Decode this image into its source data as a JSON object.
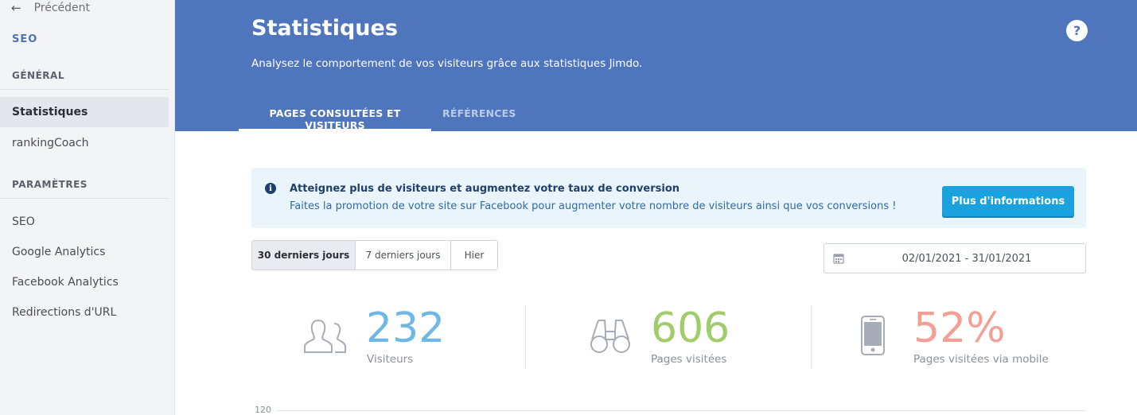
{
  "sidebar": {
    "back_label": "Précédent",
    "title": "SEO",
    "sections": [
      {
        "label": "GÉNÉRAL",
        "items": [
          "Statistiques",
          "rankingCoach"
        ]
      },
      {
        "label": "PARAMÈTRES",
        "items": [
          "SEO",
          "Google Analytics",
          "Facebook Analytics",
          "Redirections d'URL"
        ]
      }
    ],
    "active_item": "Statistiques"
  },
  "header": {
    "title": "Statistiques",
    "subtitle": "Analysez le comportement de vos visiteurs grâce aux statistiques Jimdo.",
    "help_label": "?",
    "tabs": [
      {
        "label": "PAGES CONSULTÉES ET VISITEURS",
        "active": true
      },
      {
        "label": "RÉFÉRENCES",
        "active": false
      }
    ]
  },
  "banner": {
    "title": "Atteignez plus de visiteurs et augmentez votre taux de conversion",
    "text": "Faites la promotion de votre site sur Facebook pour augmenter votre nombre de visiteurs ainsi que vos conversions !",
    "button_label": "Plus d'informations"
  },
  "range_buttons": [
    "30 derniers jours",
    "7 derniers jours",
    "Hier"
  ],
  "selected_range": "30 derniers jours",
  "date_range": "02/01/2021 - 31/01/2021",
  "stats": [
    {
      "value": "232",
      "label": "Visiteurs",
      "color": "#6fb8e6",
      "icon": "visitors-icon"
    },
    {
      "value": "606",
      "label": "Pages visitées",
      "color": "#a0cc6b",
      "icon": "binoculars-icon"
    },
    {
      "value": "52%",
      "label": "Pages visitées via mobile",
      "color": "#f2a095",
      "icon": "mobile-icon"
    }
  ],
  "chart": {
    "y_tick_top": "120"
  },
  "colors": {
    "header_blue": "#4f75bd",
    "button_blue": "#1aa2de",
    "banner_bg": "#eaf5fb",
    "sidebar_bg": "#f3f4f6"
  }
}
